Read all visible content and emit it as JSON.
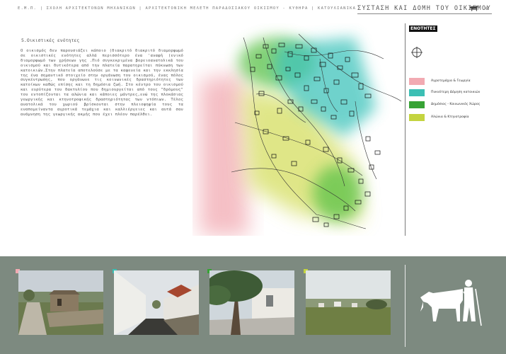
{
  "header": {
    "breadcrumb": "Ε.Μ.Π. | ΣΧΟΛΗ ΑΡΧΙΤΕΚΤΟΝΩΝ ΜΗΧΑΝΙΚΩΝ | ΑΡΧΙΤΕΚΤΟΝΙΚΗ ΜΕΛΕΤΗ ΠΑΡΑΔΟΣΙΑΚΟΥ ΟΙΚΙΣΜΟΥ - ΚΥΘΗΡΑ | ΚΑΤΟΥΛΙΑΝΙΚΑ",
    "title": "ΣΥΣΤΑΣΗ ΚΑΙ ΔΟΜΗ ΤΟΥ ΟΙΚΙΣΜΟΥ",
    "page_number": "6",
    "logo_icon": "goat-icon"
  },
  "text": {
    "heading": "5.Οικιστικές ενότητες",
    "body": "Ο οικισμός δεν παρουσιάζει κάποιο (διακριτό διακριτό διαμορφωμό σε οικιστικές ενότητες αλλά περισσότερο ένα 'αναφή (ενικό διαμορφωμό των χρήσεων γης .Πιό συγκεκριμένα βορειοανατολικά του οικισμού και δυτικότερα από την πλατεία παρατηρείται πύκνωση των κατοικιών.Στην πλατεία αποτελούσε με τα καφενεία και την εκκλησία της ένα σημαντικό στοιχείο στην οργάνωση του οικισμού, ένας πόλος συγκέντρωσης, που οργάνωνε τις κοινωνικές δραστηριότητες των κατοίκων καθώς επίσης και τη δημόσια ζωή. Στο κέντρο του οικισμού και ευρύτερα του δακτυλίου που δημιουργείται από τους \"δρόμους\" του εντοπίζονται τα αλώνια και κάποιες μάντρες,ενώ της πλοκάσιας γεωργικής και κτηνοτροφικής δραστηριότητας των ντόπιων. Τέλος ανατολικά του χωριού βρίσκονται στην πλειοψηφία τους τα εναπομείναντα αγροτικά τεμάχια και καλλιέργειες και αυτά σαν ανάμνηση της γεωργικής ακμής που έχει πλέον παρέλθει."
  },
  "legend": {
    "title": "ΕΝΟΤΗΤΕΣ",
    "compass_icon": "north-arrow-icon",
    "items": [
      {
        "label": "Αγροτεμάχια & Γεωργία",
        "color": "#f2aab2"
      },
      {
        "label": "Πυκνότερη Δόμηση κατοικιών",
        "color": "#3cbfb4"
      },
      {
        "label": "Δημόσιος - Κοινωνικός Χώρος",
        "color": "#37a335"
      },
      {
        "label": "Αλώνια & Κτηνοτροφία",
        "color": "#c4d440"
      }
    ]
  },
  "photos": [
    {
      "marker_color": "#f2aab2",
      "subject": "rural path with stone hut"
    },
    {
      "marker_color": "#3cbfb4",
      "subject": "narrow street between white houses"
    },
    {
      "marker_color": "#37a335",
      "subject": "village square with tree"
    },
    {
      "marker_color": "#c4d440",
      "subject": "fields and landscape"
    }
  ],
  "footer_logo_icon": "ox-and-farmer-icon"
}
